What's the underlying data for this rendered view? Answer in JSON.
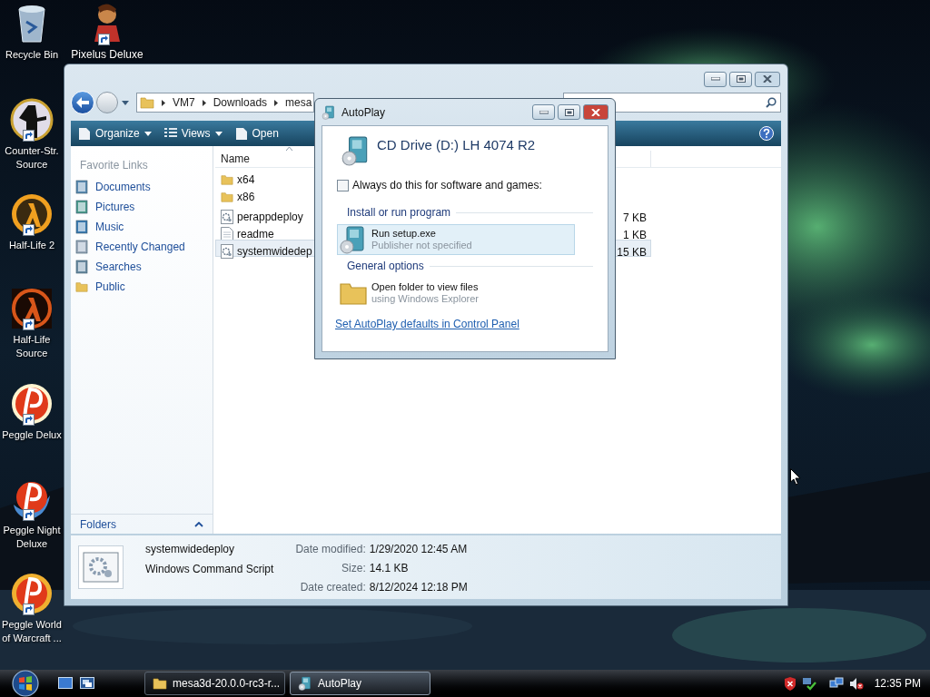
{
  "desktop_icons": [
    {
      "label": "Recycle Bin",
      "shortcut": false
    },
    {
      "label": "Pixelus Deluxe",
      "shortcut": true
    },
    {
      "label": "Counter-Str. Source",
      "shortcut": true
    },
    {
      "label": "Half-Life 2",
      "shortcut": true
    },
    {
      "label": "Half-Life Source",
      "shortcut": true
    },
    {
      "label": "Peggle Delux",
      "shortcut": true
    },
    {
      "label": "Peggle Night Deluxe",
      "shortcut": true
    },
    {
      "label": "Peggle World of Warcraft ...",
      "shortcut": true
    }
  ],
  "explorer": {
    "breadcrumb": [
      "VM7",
      "Downloads",
      "mesa"
    ],
    "toolbar": [
      {
        "label": "Organize",
        "dropdown": true
      },
      {
        "label": "Views",
        "dropdown": true
      },
      {
        "label": "Open",
        "dropdown": false
      }
    ],
    "favorite_links": {
      "heading": "Favorite Links",
      "items": [
        "Documents",
        "Pictures",
        "Music",
        "Recently Changed",
        "Searches",
        "Public"
      ]
    },
    "folders_bar": "Folders",
    "columns": [
      "Name"
    ],
    "files": [
      {
        "name": "x64",
        "kind": "folder",
        "selected": false
      },
      {
        "name": "x86",
        "kind": "folder",
        "selected": false
      },
      {
        "name": "perappdeploy",
        "kind": "script",
        "size": "7 KB",
        "selected": false
      },
      {
        "name": "readme",
        "kind": "text",
        "size": "1 KB",
        "selected": false
      },
      {
        "name": "systemwidedep",
        "kind": "script",
        "size": "15 KB",
        "selected": true
      }
    ],
    "details": {
      "name": "systemwidedeploy",
      "type": "Windows Command Script",
      "fields": [
        {
          "label": "Date modified:",
          "value": "1/29/2020 12:45 AM"
        },
        {
          "label": "Size:",
          "value": "14.1 KB"
        },
        {
          "label": "Date created:",
          "value": "8/12/2024 12:18 PM"
        }
      ]
    }
  },
  "autoplay": {
    "title": "AutoPlay",
    "device": "CD Drive (D:) LH 4074 R2",
    "always": {
      "label": "Always do this for software and games:",
      "checked": false
    },
    "sections": [
      {
        "heading": "Install or run program",
        "options": [
          {
            "title": "Run setup.exe",
            "subtitle": "Publisher not specified",
            "kind": "disc",
            "selected": true
          }
        ]
      },
      {
        "heading": "General options",
        "options": [
          {
            "title": "Open folder to view files",
            "subtitle": "using Windows Explorer",
            "kind": "folder",
            "selected": false
          }
        ]
      }
    ],
    "link": "Set AutoPlay defaults in Control Panel"
  },
  "taskbar": {
    "tasks": [
      {
        "label": "mesa3d-20.0.0-rc3-r...",
        "kind": "folder",
        "selected": false
      },
      {
        "label": "AutoPlay",
        "kind": "disc",
        "selected": true
      }
    ],
    "clock": "12:35 PM"
  }
}
